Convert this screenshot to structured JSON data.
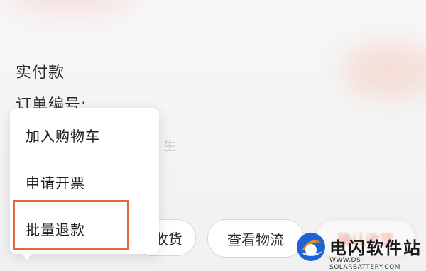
{
  "page": {
    "labels": {
      "paid": "实付款",
      "order_no": "订单编号:",
      "hint_fragment": "生"
    }
  },
  "actions": {
    "receive_fragment": "收货",
    "view_logistics": "查看物流",
    "confirm_receipt": "确认收货"
  },
  "menu": {
    "items": [
      {
        "label": "加入购物车"
      },
      {
        "label": "申请开票"
      },
      {
        "label": "批量退款",
        "highlighted": true
      }
    ]
  },
  "watermark": {
    "title": "电闪软件站",
    "subtitle": "WWW.DS-SOLARBATTERY.COM"
  },
  "colors": {
    "highlight": "#e5673c",
    "logo_blue": "#1e63d6",
    "logo_orange": "#f08a1e"
  }
}
